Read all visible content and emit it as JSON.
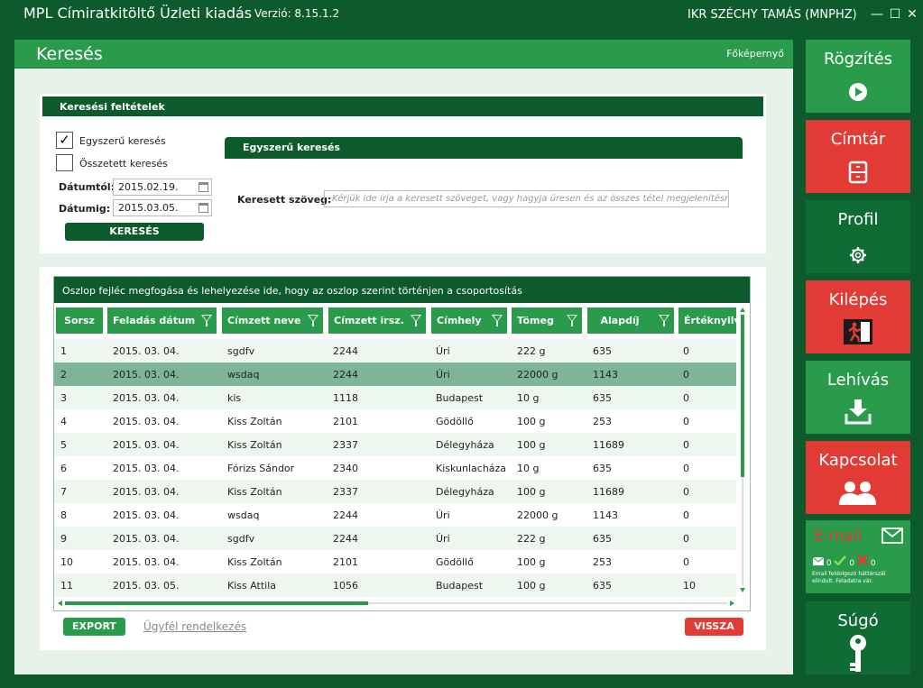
{
  "titlebar": {
    "app_title": "MPL Címiratkitöltő Üzleti kiadás",
    "version": "Verzió: 8.15.1.2",
    "user": "IKR SZÉCHY TAMÁS (MNPHZ)",
    "minimize": "—",
    "maximize": "☐",
    "close": "✕"
  },
  "main": {
    "title": "Keresés",
    "home_link": "Főképernyő"
  },
  "search": {
    "header": "Keresési feltételek",
    "simple_label": "Egyszerű keresés",
    "simple_checked_mark": "✓",
    "complex_label": "Összetett keresés",
    "date_from_label": "Dátumtól:",
    "date_from_value": "2015.02.19.",
    "date_to_label": "Dátumig:",
    "date_to_value": "2015.03.05.",
    "search_button": "KERESÉS",
    "simple_section_title": "Egyszerű keresés",
    "text_label": "Keresett szöveg:",
    "text_placeholder": "Kérjük ide írja a keresett szöveget, vagy hagyja üresen és az összes tétel megjelenítésre kerül"
  },
  "grid": {
    "group_hint": "Oszlop fejléc megfogása és lehelyezése ide, hogy az oszlop szerint történjen a csoportosítás",
    "columns": [
      "Sorsz",
      "Feladás dátum",
      "Címzett neve",
      "Címzett irsz.",
      "Címhely",
      "Tömeg",
      "Alapdíj",
      "Értéknyilv"
    ],
    "rows": [
      [
        "1",
        "2015. 03. 04.",
        "sgdfv",
        "2244",
        "Úri",
        "222 g",
        "635",
        "0"
      ],
      [
        "2",
        "2015. 03. 04.",
        "wsdaq",
        "2244",
        "Úri",
        "22000 g",
        "1143",
        "0"
      ],
      [
        "3",
        "2015. 03. 04.",
        "kis",
        "1118",
        "Budapest",
        "10 g",
        "635",
        "0"
      ],
      [
        "4",
        "2015. 03. 04.",
        "Kiss Zoltán",
        "2101",
        "Gödöllő",
        "100 g",
        "253",
        "0"
      ],
      [
        "5",
        "2015. 03. 04.",
        "Kiss Zoltán",
        "2337",
        "Délegyháza",
        "100 g",
        "11689",
        "0"
      ],
      [
        "6",
        "2015. 03. 04.",
        "Fórizs Sándor",
        "2340",
        "Kiskunlacháza",
        "10 g",
        "635",
        "0"
      ],
      [
        "7",
        "2015. 03. 04.",
        "Kiss Zoltán",
        "2337",
        "Délegyháza",
        "100 g",
        "11689",
        "0"
      ],
      [
        "8",
        "2015. 03. 04.",
        "wsdaq",
        "2244",
        "Úri",
        "22000 g",
        "1143",
        "0"
      ],
      [
        "9",
        "2015. 03. 04.",
        "sgdfv",
        "2244",
        "Úri",
        "222 g",
        "635",
        "0"
      ],
      [
        "10",
        "2015. 03. 04.",
        "Kiss Zoltán",
        "2101",
        "Gödöllő",
        "100 g",
        "253",
        "0"
      ],
      [
        "11",
        "2015. 03. 05.",
        "Kiss Attila",
        "1056",
        "Budapest",
        "100 g",
        "635",
        "10"
      ]
    ],
    "selected_row": 1
  },
  "footer": {
    "export": "EXPORT",
    "ugyfel": "Ügyfél rendelkezés",
    "back": "VISSZA"
  },
  "tiles": {
    "rogzites": "Rögzítés",
    "cimtar": "Címtár",
    "profil": "Profil",
    "kilepes": "Kilépés",
    "lehivas": "Lehívás",
    "kapcsolat": "Kapcsolat",
    "email": "E-mail",
    "email_count_mail": "0",
    "email_count_ok": "0",
    "email_count_err": "0",
    "email_note": "Email feldolgozó háttérszál elindult. Feladatra vár.",
    "sugo": "Súgó"
  },
  "colors": {
    "dark_green": "#0d5a2c",
    "green": "#2a9b4b",
    "red": "#e23b36",
    "selected_row": "#7eb595"
  }
}
